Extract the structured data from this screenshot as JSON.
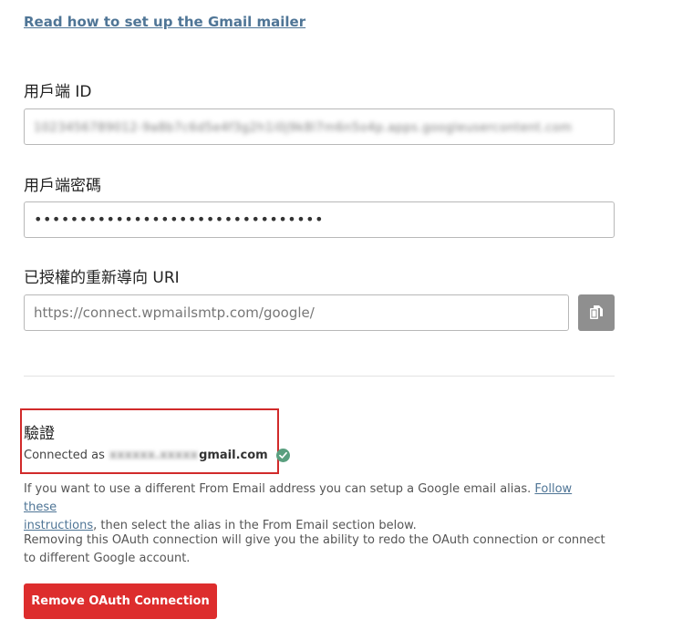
{
  "doc_link": "Read how to set up the Gmail mailer",
  "client_id": {
    "label": "用戶端 ID",
    "value": "1023456789012-9a8b7c6d5e4f3g2h1i0j9k8l7m6n5o4p.apps.googleusercontent.com"
  },
  "client_secret": {
    "label": "用戶端密碼",
    "value": "••••••••••••••••••••••••••••••••"
  },
  "redirect_uri": {
    "label": "已授權的重新導向 URI",
    "value": "https://connect.wpmailsmtp.com/google/"
  },
  "icons": {
    "copy": "copy-icon",
    "check": "check-circle-icon"
  },
  "auth": {
    "title": "驗證",
    "connected_prefix": "Connected as",
    "email_local": "xxxxxx.xxxxx",
    "email_domain": "gmail.com"
  },
  "alias_note": {
    "text_before": "If you want to use a different From Email address you can setup a Google email alias.",
    "link_part1": "Follow these",
    "link_part2": "instructions",
    "text_after": ", then select the alias in the From Email section below."
  },
  "remove_note": "Removing this OAuth connection will give you the ability to redo the OAuth connection or connect to different Google account.",
  "remove_button": "Remove OAuth Connection",
  "colors": {
    "link": "#4f7596",
    "danger": "#dd2d2d",
    "success": "#5a9f7f",
    "highlight_border": "#d12a2a"
  }
}
